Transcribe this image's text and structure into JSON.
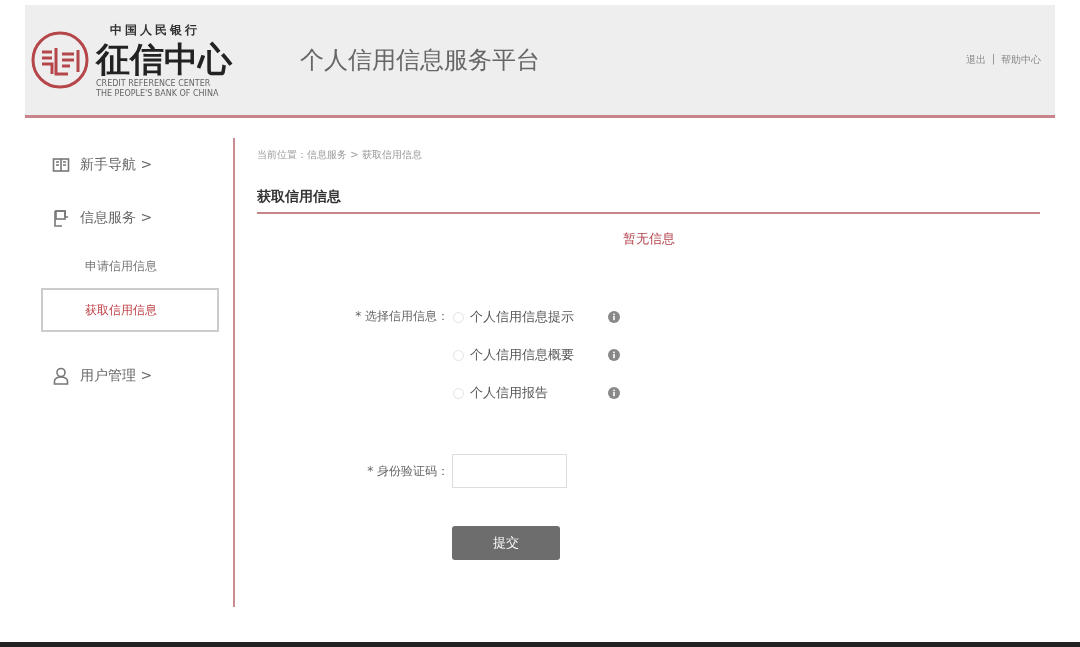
{
  "header": {
    "logo": {
      "top_line": "中国人民银行",
      "name": "征信中心",
      "english": [
        "CREDIT REFERENCE CENTER",
        "THE PEOPLE'S BANK OF CHINA"
      ]
    },
    "title": "个人信用信息服务平台",
    "links": [
      "退出",
      "帮助中心"
    ],
    "separator": "|"
  },
  "sidebar": {
    "items": [
      {
        "label": "新手导航 >"
      },
      {
        "label": "信息服务 >",
        "children": [
          {
            "label": "申请信用信息",
            "selected": false
          },
          {
            "label": "获取信用信息",
            "selected": true
          }
        ]
      },
      {
        "label": "用户管理 >"
      }
    ]
  },
  "main": {
    "breadcrumb": "当前位置：信息服务 > 获取信用信息",
    "heading": "获取信用信息",
    "notice": "暂无信息",
    "form": {
      "choice_label": "* 选择信用信息：",
      "options": [
        {
          "label": "个人信用信息提示",
          "selected": false
        },
        {
          "label": "个人信用信息概要",
          "selected": false
        },
        {
          "label": "个人信用报告",
          "selected": false
        }
      ],
      "code_label": "* 身份验证码：",
      "submit": "提交"
    }
  }
}
